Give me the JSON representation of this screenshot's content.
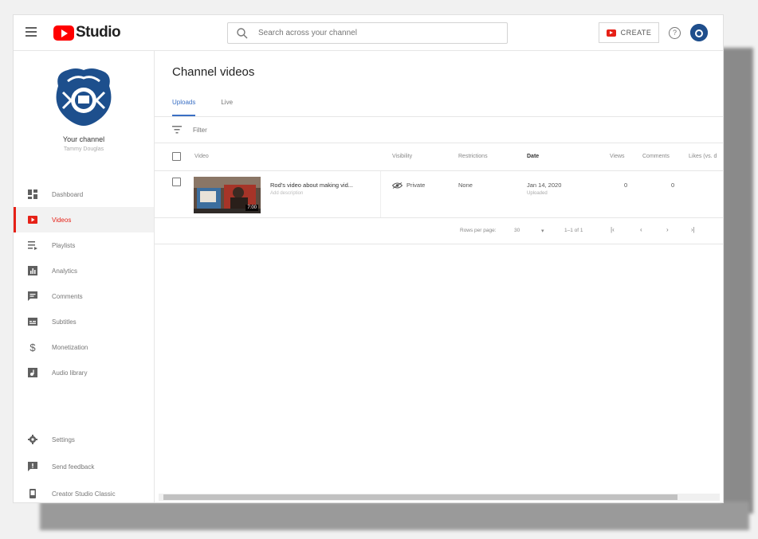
{
  "header": {
    "app_name": "Studio",
    "search_placeholder": "Search across your channel",
    "create_label": "CREATE",
    "help_glyph": "?"
  },
  "sidebar": {
    "channel_name": "Your channel",
    "channel_sub": "Tammy Douglas",
    "items": [
      {
        "label": "Dashboard",
        "icon": "dashboard-icon",
        "active": false
      },
      {
        "label": "Videos",
        "icon": "videos-icon",
        "active": true
      },
      {
        "label": "Playlists",
        "icon": "playlists-icon",
        "active": false
      },
      {
        "label": "Analytics",
        "icon": "analytics-icon",
        "active": false
      },
      {
        "label": "Comments",
        "icon": "comments-icon",
        "active": false
      },
      {
        "label": "Subtitles",
        "icon": "subtitles-icon",
        "active": false
      },
      {
        "label": "Monetization",
        "icon": "monetization-icon",
        "active": false
      },
      {
        "label": "Audio library",
        "icon": "audio-library-icon",
        "active": false
      }
    ],
    "bottom_items": [
      {
        "label": "Settings",
        "icon": "gear-icon"
      },
      {
        "label": "Send feedback",
        "icon": "feedback-icon"
      },
      {
        "label": "Creator Studio Classic",
        "icon": "classic-icon"
      }
    ]
  },
  "main": {
    "title": "Channel videos",
    "tabs": [
      {
        "label": "Uploads",
        "active": true
      },
      {
        "label": "Live",
        "active": false
      }
    ],
    "filter_placeholder": "Filter",
    "columns": [
      "Video",
      "Visibility",
      "Restrictions",
      "Date",
      "Views",
      "Comments",
      "Likes (vs. d"
    ],
    "rows": [
      {
        "title": "Rod's video about making vid...",
        "description": "Add description",
        "duration": "7:00",
        "visibility": "Private",
        "restrictions": "None",
        "date": "Jan 14, 2020",
        "date_sub": "Uploaded",
        "views": "0",
        "comments": "0"
      }
    ],
    "pagination": {
      "rows_per_page_label": "Rows per page:",
      "rows_per_page": "30",
      "range": "1–1 of 1",
      "first": "|‹",
      "prev": "‹",
      "next": "›",
      "last": "›|"
    }
  },
  "colors": {
    "brand_red": "#ff0000",
    "active_tab_blue": "#3a6fc4"
  }
}
